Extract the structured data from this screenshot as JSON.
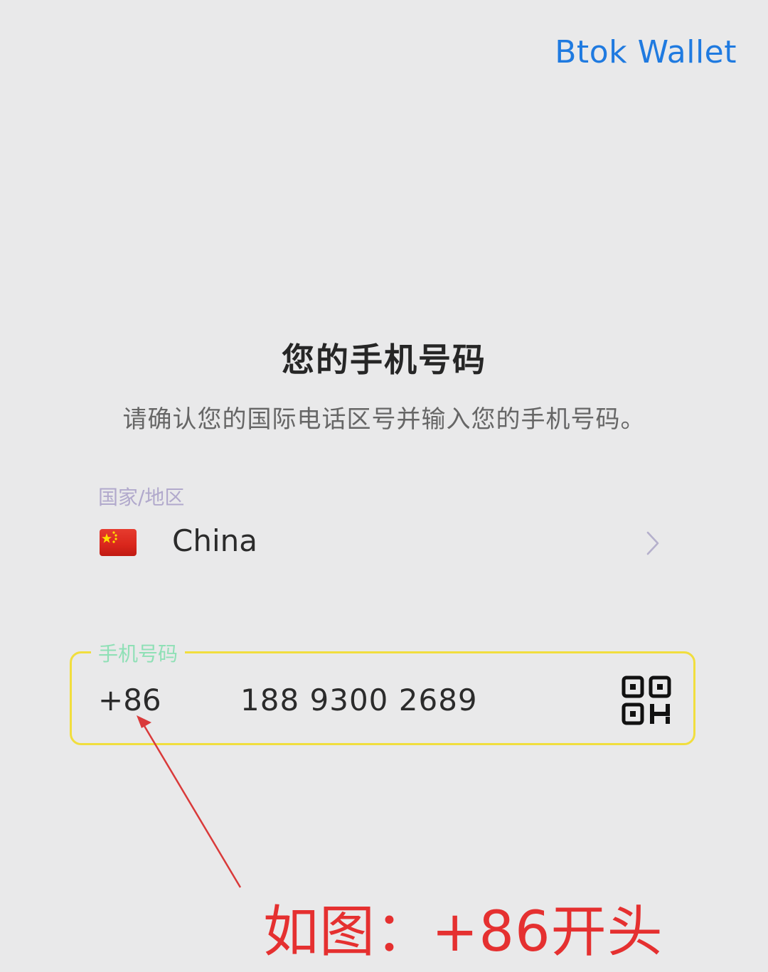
{
  "header": {
    "app_link": "Btok Wallet"
  },
  "main": {
    "title": "您的手机号码",
    "subtitle": "请确认您的国际电话区号并输入您的手机号码。"
  },
  "country_field": {
    "label": "国家/地区",
    "value": "China",
    "flag_icon": "cn-flag-icon",
    "chevron_icon": "chevron-right-icon"
  },
  "phone_field": {
    "label": "手机号码",
    "dial_code": "+86",
    "number": "188 9300 2689",
    "action_icon": "qr-scan-icon"
  },
  "annotation": {
    "text": "如图：+86开头"
  },
  "colors": {
    "background": "#e9e9ea",
    "link": "#1f7ae0",
    "focus_border": "#f1de3e",
    "field_label_active": "#8fe0b6",
    "annotation": "#e53030"
  }
}
